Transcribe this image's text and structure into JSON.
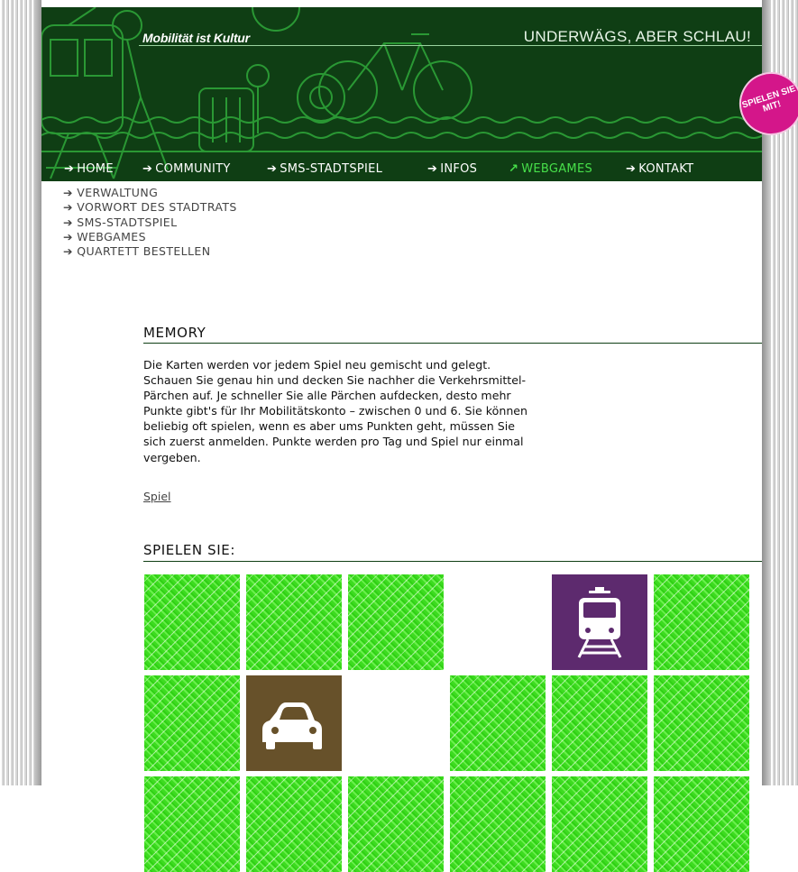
{
  "header": {
    "brand": "Mobilität ist Kultur",
    "slogan": "UNDERWÄGS, ABER SCHLAU!",
    "badge": "SPIELEN SIE MIT!"
  },
  "nav": [
    {
      "label": "HOME",
      "active": false
    },
    {
      "label": "COMMUNITY",
      "active": false
    },
    {
      "label": "SMS-STADTSPIEL",
      "active": false
    },
    {
      "label": "INFOS",
      "active": false
    },
    {
      "label": "WEBGAMES",
      "active": true
    },
    {
      "label": "KONTAKT",
      "active": false
    }
  ],
  "submenu": [
    {
      "label": "VERWALTUNG"
    },
    {
      "label": "VORWORT DES STADTRATS"
    },
    {
      "label": "SMS-STADTSPIEL"
    },
    {
      "label": "WEBGAMES"
    },
    {
      "label": "QUARTETT BESTELLEN"
    }
  ],
  "memory": {
    "title": "MEMORY",
    "description": "Die Karten werden vor jedem Spiel neu gemischt und gelegt. Schauen Sie genau hin und decken Sie nachher die Verkehrsmittel-Pärchen auf. Je schneller Sie alle Pärchen aufdecken, desto mehr Punkte gibt's für Ihr Mobilitätskonto – zwischen 0 und 6. Sie können beliebig oft spielen, wenn es aber ums Punkten geht, müssen Sie sich zuerst anmelden. Punkte werden pro Tag und Spiel nur einmal vergeben.",
    "link": "Spiel"
  },
  "game": {
    "title": "SPIELEN SIE:",
    "rows": [
      [
        "back",
        "back",
        "back",
        "empty",
        "train",
        "back"
      ],
      [
        "back",
        "car",
        "empty",
        "back",
        "back",
        "back"
      ],
      [
        "back",
        "back",
        "back",
        "back",
        "back",
        "back"
      ]
    ]
  },
  "colors": {
    "header_bg": "#0f3e14",
    "nav_active": "#47e04a",
    "card_green": "#4fe62e",
    "card_train": "#5d2a6e",
    "card_car": "#67512a",
    "badge": "#d4168a"
  }
}
